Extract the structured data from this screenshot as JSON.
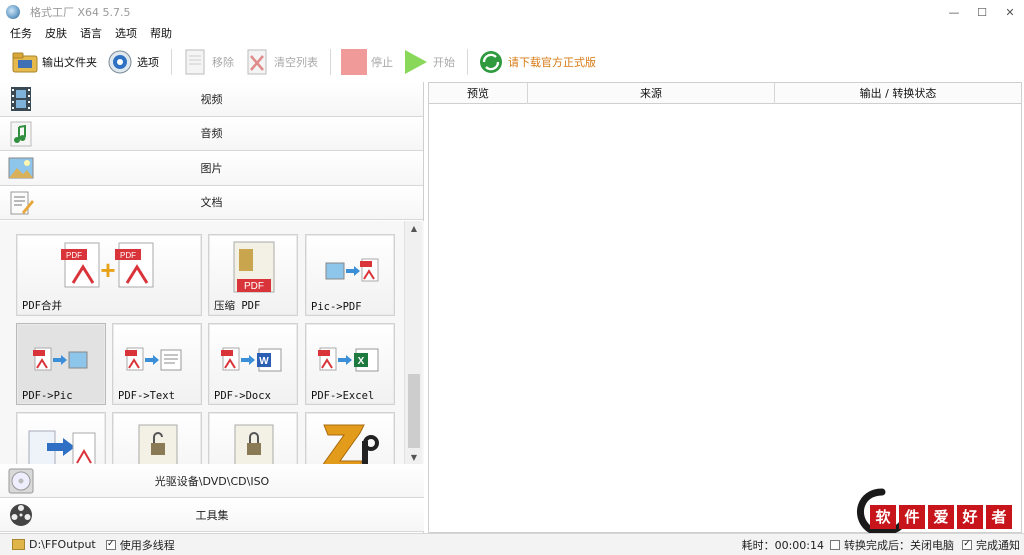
{
  "window": {
    "title": "格式工厂 X64 5.7.5"
  },
  "window_controls": {
    "minimize": "—",
    "maximize": "☐",
    "close": "✕"
  },
  "menu": [
    "任务",
    "皮肤",
    "语言",
    "选项",
    "帮助"
  ],
  "toolbar": {
    "output_folder": "输出文件夹",
    "options": "选项",
    "remove": "移除",
    "clear_list": "清空列表",
    "stop": "停止",
    "start": "开始",
    "download": "请下载官方正式版"
  },
  "categories": {
    "video": "视频",
    "audio": "音频",
    "image": "图片",
    "document": "文档",
    "optical": "光驱设备\\DVD\\CD\\ISO",
    "tools": "工具集"
  },
  "tiles": [
    "PDF合并",
    "压缩 PDF",
    "Pic->PDF",
    "PDF->Pic",
    "PDF->Text",
    "PDF->Docx",
    "PDF->Excel",
    "",
    "",
    "",
    ""
  ],
  "table": {
    "columns": [
      "预览",
      "来源",
      "输出 / 转换状态"
    ]
  },
  "statusbar": {
    "output_path": "D:\\FFOutput",
    "multithread_label": "使用多线程",
    "multithread_checked": true,
    "time_label": "耗时：00:00:14",
    "shutdown_label": "转换完成后：关闭电脑",
    "shutdown_checked": false,
    "notify_label": "完成通知",
    "notify_checked": true
  },
  "watermark": {
    "chars": [
      "软",
      "件",
      "爱",
      "好",
      "者"
    ]
  },
  "colors": {
    "accent_red": "#c8151b",
    "pdf_red": "#d9343a",
    "download_orange": "#d87a13",
    "start_green": "#7fd24a",
    "stop_red": "#f08c8c"
  }
}
